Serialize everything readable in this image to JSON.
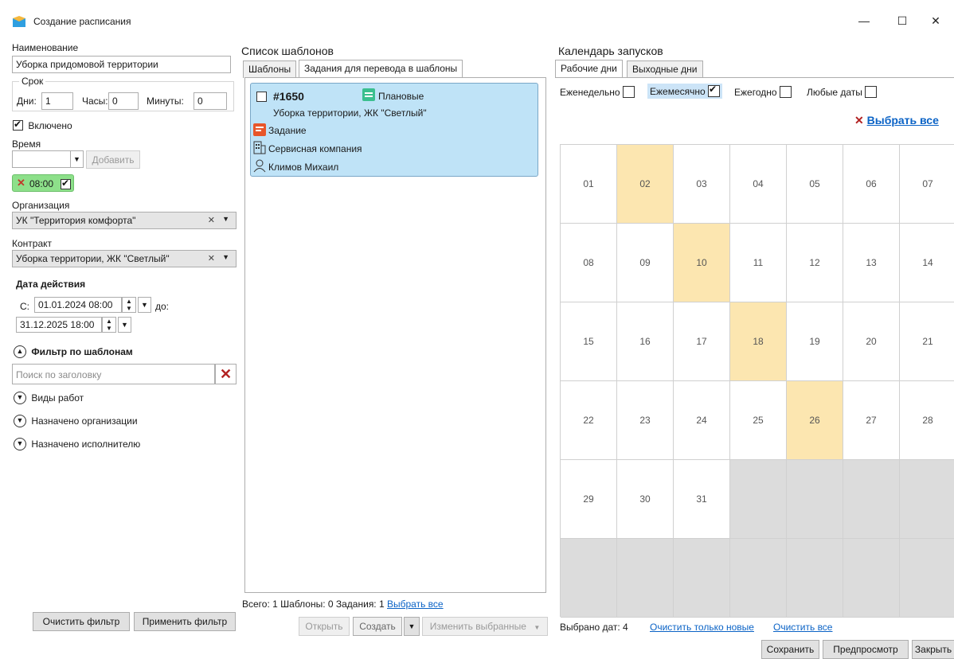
{
  "window": {
    "title": "Создание расписания",
    "minimize": "—",
    "maximize": "☐",
    "close": "✕"
  },
  "left": {
    "name_label": "Наименование",
    "name_value": "Уборка придомовой территории",
    "term_label": "Срок",
    "days_label": "Дни:",
    "days_value": "1",
    "hours_label": "Часы:",
    "hours_value": "0",
    "minutes_label": "Минуты:",
    "minutes_value": "0",
    "enabled_label": "Включено",
    "time_label": "Время",
    "add_button": "Добавить",
    "time_tag": "08:00",
    "org_label": "Организация",
    "org_value": "УК \"Территория комфорта\"",
    "contract_label": "Контракт",
    "contract_value": "Уборка территории, ЖК \"Светлый\"",
    "date_label": "Дата действия",
    "from_label": "С:",
    "from_value": "01.01.2024 08:00",
    "to_label": "до:",
    "to_value": "31.12.2025 18:00",
    "filter_title": "Фильтр по шаблонам",
    "search_placeholder": "Поиск по заголовку",
    "filters": [
      "Виды работ",
      "Назначено организации",
      "Назначено исполнителю"
    ],
    "clear_filter": "Очистить фильтр",
    "apply_filter": "Применить фильтр"
  },
  "middle": {
    "title": "Список шаблонов",
    "tabs": [
      "Шаблоны",
      "Задания для перевода в шаблоны"
    ],
    "card": {
      "number": "#1650",
      "category": "Плановые",
      "subtitle": "Уборка территории, ЖК \"Светлый\"",
      "type": "Задание",
      "company": "Сервисная компания",
      "person": "Климов Михаил"
    },
    "summary": "Всего: 1 Шаблоны: 0 Задания: 1",
    "select_all": "Выбрать все",
    "open_button": "Открыть",
    "create_button": "Создать",
    "change_button": "Изменить выбранные"
  },
  "right": {
    "title": "Календарь запусков",
    "tabs": [
      "Рабочие дни",
      "Выходные дни"
    ],
    "modes": [
      "Еженедельно",
      "Ежемесячно",
      "Ежегодно",
      "Любые даты"
    ],
    "select_all": "Выбрать все",
    "days": [
      "01",
      "02",
      "03",
      "04",
      "05",
      "06",
      "07",
      "08",
      "09",
      "10",
      "11",
      "12",
      "13",
      "14",
      "15",
      "16",
      "17",
      "18",
      "19",
      "20",
      "21",
      "22",
      "23",
      "24",
      "25",
      "26",
      "27",
      "28",
      "29",
      "30",
      "31"
    ],
    "selected_days": [
      "02",
      "10",
      "18",
      "26"
    ],
    "footer_selected": "Выбрано дат: 4",
    "clear_new": "Очистить только новые",
    "clear_all": "Очистить все"
  },
  "bottom": {
    "save": "Сохранить",
    "preview": "Предпросмотр",
    "close": "Закрыть"
  }
}
